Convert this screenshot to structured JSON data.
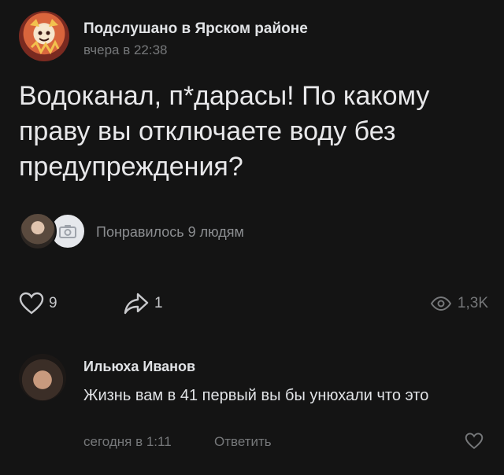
{
  "post": {
    "group_name": "Подслушано в Ярском районе",
    "time": "вчера в 22:38",
    "text": "Водоканал, п*дарасы! По какому праву вы отключаете воду без предупреждения?",
    "likes_summary": "Понравилось 9 людям"
  },
  "actions": {
    "like_count": "9",
    "share_count": "1",
    "views_count": "1,3K"
  },
  "comment": {
    "author": "Ильюха Иванов",
    "text": "Жизнь вам в 41 первый вы бы унюхали что это",
    "time": "сегодня в 1:11",
    "reply_label": "Ответить"
  },
  "icons": {
    "like": "heart-icon",
    "share": "share-arrow-icon",
    "views": "eye-icon",
    "comment_like": "heart-icon",
    "liker_placeholder": "camera-icon"
  },
  "colors": {
    "background": "#141414",
    "text_primary": "#e1e3e6",
    "text_secondary": "#76787a"
  }
}
